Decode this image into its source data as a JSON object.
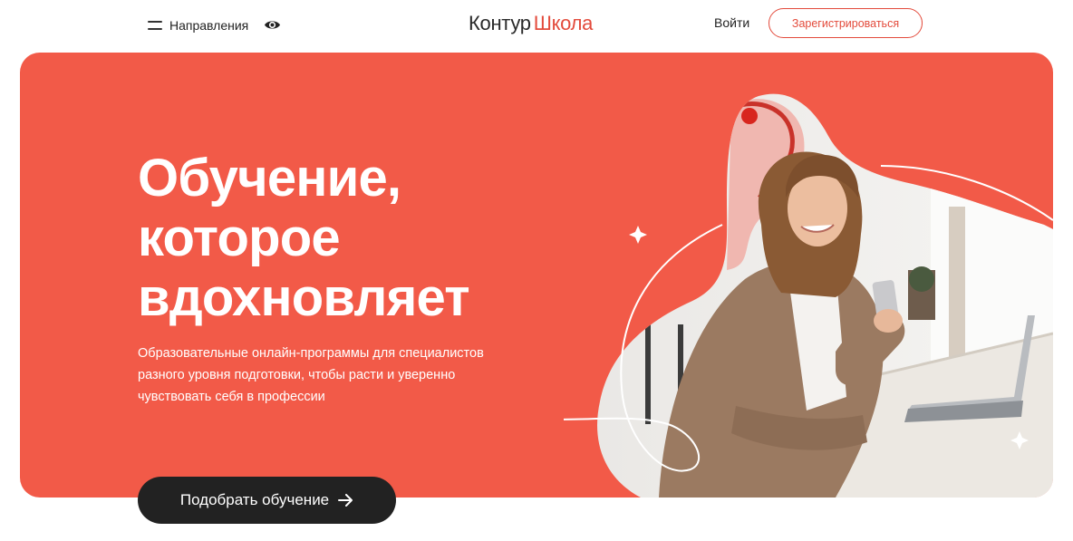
{
  "header": {
    "nav_label": "Направления",
    "logo_part1": "Контур",
    "logo_part2": "Школа",
    "login_label": "Войти",
    "register_label": "Зарегистрироваться"
  },
  "hero": {
    "title_lines": [
      "Обучение,",
      "которое",
      "вдохновляет"
    ],
    "subtitle_lines": [
      "Образовательные онлайн-программы для специалистов",
      "разного уровня подготовки, чтобы расти и уверенно",
      "чувствовать себя в профессии"
    ],
    "image_alt": "woman-with-phone-and-laptop"
  },
  "cta": {
    "label": "Подобрать обучение"
  },
  "colors": {
    "accent": "#f25a48",
    "brand_red": "#e34b3c",
    "dark": "#222222",
    "background": "#ffffff"
  },
  "icons": {
    "menu": "hamburger-icon",
    "accessibility": "eye-icon",
    "cta_arrow": "arrow-right-icon",
    "sparkle": "sparkle-icon"
  }
}
